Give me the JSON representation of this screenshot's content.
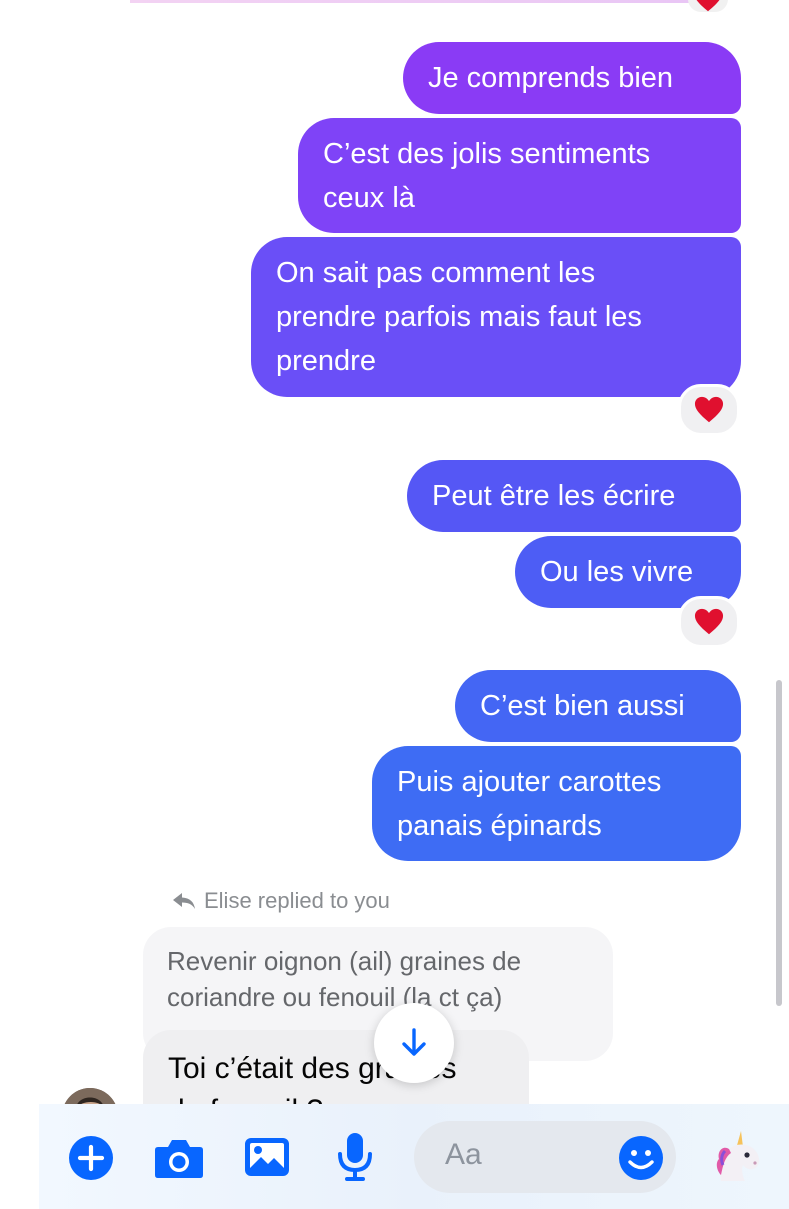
{
  "thread": {
    "messages_out": [
      {
        "text": "Je comprends bien",
        "color": "#8a3bf5"
      },
      {
        "text": "C’est des jolis sentiments\nceux là",
        "color": "#7f43f7"
      },
      {
        "text": "On sait pas comment les\nprendre parfois mais faut les\nprendre",
        "color": "#6a4ff7"
      },
      {
        "text": "Peut être les écrire",
        "color": "#5557f5"
      },
      {
        "text": "Ou les vivre",
        "color": "#4d5df5"
      },
      {
        "text": "C’est bien aussi",
        "color": "#4466f4"
      },
      {
        "text": "Puis ajouter carottes\npanais épinards",
        "color": "#3e6cf4"
      }
    ],
    "reply_hint": "Elise replied to you",
    "quoted_message": "Revenir oignon (ail) graines de coriandre ou fenouil (la ct ça)",
    "incoming_message": "Toi c’était des graines\nde fenouil ?",
    "reactions": [
      "heart",
      "heart",
      "heart"
    ]
  },
  "composer": {
    "placeholder": "Aa",
    "buttons": [
      "plus-icon",
      "camera-icon",
      "gallery-icon",
      "microphone-icon",
      "emoji-icon",
      "unicorn-icon"
    ]
  },
  "colors": {
    "accent": "#0866ff",
    "quoted_bg": "#f5f5f7"
  }
}
